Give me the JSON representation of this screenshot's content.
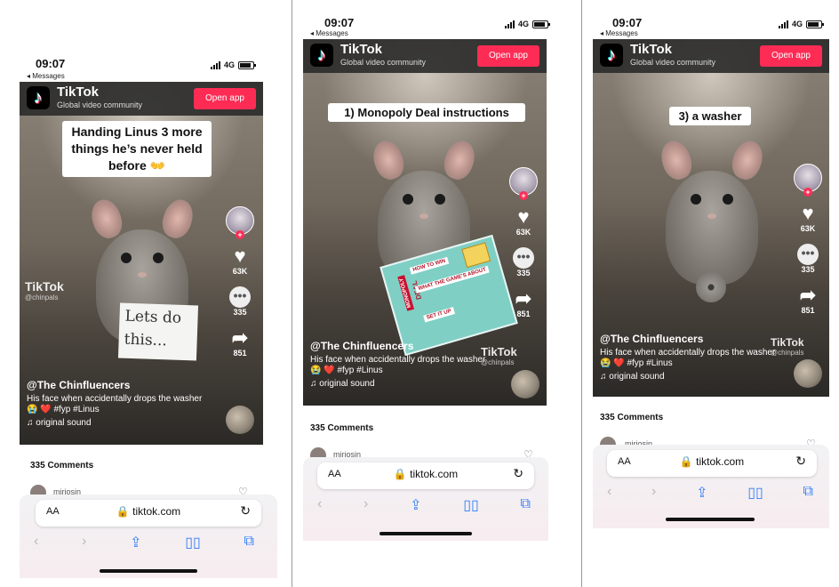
{
  "panels": [
    {
      "status": {
        "time": "09:07",
        "back": "◂ Messages",
        "network": "4G"
      },
      "app": {
        "name": "TikTok",
        "subtitle": "Global video community",
        "open_label": "Open app"
      },
      "caption": "Handing Linus 3 more things he’s never held before 👐",
      "sign": "Lets do this...",
      "watermark": {
        "brand": "TikTok",
        "handle": "@chinpals"
      },
      "actions": {
        "likes": "63K",
        "comments": "335",
        "shares": "851"
      },
      "post": {
        "user": "@The Chinfluencers",
        "description": "His face when accidentally drops the washer",
        "tags": "😭 ❤️ #fyp #Linus",
        "sound": "original sound"
      },
      "comments_label": "335 Comments",
      "commenter": "miriosin",
      "browser": {
        "aa": "AA",
        "url": "tiktok.com"
      }
    },
    {
      "status": {
        "time": "09:07",
        "back": "◂ Messages",
        "network": "4G"
      },
      "app": {
        "name": "TikTok",
        "subtitle": "Global video community",
        "open_label": "Open app"
      },
      "caption": "1) Monopoly Deal instructions",
      "card": {
        "brand": "MONOPOLY",
        "deal": "DEAL",
        "line1": "HOW TO WIN",
        "line2": "WHAT THE GAME'S ABOUT",
        "line3": "SET IT UP"
      },
      "watermark": {
        "brand": "TikTok",
        "handle": "@chinpals"
      },
      "actions": {
        "likes": "63K",
        "comments": "335",
        "shares": "851"
      },
      "post": {
        "user": "@The Chinfluencers",
        "description": "His face when accidentally drops the washer",
        "tags": "😭 ❤️ #fyp #Linus",
        "sound": "original sound"
      },
      "comments_label": "335 Comments",
      "commenter": "miriosin",
      "browser": {
        "aa": "AA",
        "url": "tiktok.com"
      }
    },
    {
      "status": {
        "time": "09:07",
        "back": "◂ Messages",
        "network": "4G"
      },
      "app": {
        "name": "TikTok",
        "subtitle": "Global video community",
        "open_label": "Open app"
      },
      "caption": "3) a washer",
      "watermark": {
        "brand": "TikTok",
        "handle": "@chinpals"
      },
      "actions": {
        "likes": "63K",
        "comments": "335",
        "shares": "851"
      },
      "post": {
        "user": "@The Chinfluencers",
        "description": "His face when accidentally drops the washer",
        "tags": "😭 ❤️ #fyp #Linus",
        "sound": "original sound"
      },
      "comments_label": "335 Comments",
      "commenter": "miriosin",
      "browser": {
        "aa": "AA",
        "url": "tiktok.com"
      }
    }
  ],
  "icons": {
    "like": "heart-icon",
    "comment": "comment-icon",
    "share": "share-icon",
    "music": "music-note-icon",
    "lock": "lock-icon",
    "reload": "reload-icon"
  },
  "colors": {
    "tiktok_red": "#fe2c55",
    "safari_blue": "#2f7ef6"
  }
}
